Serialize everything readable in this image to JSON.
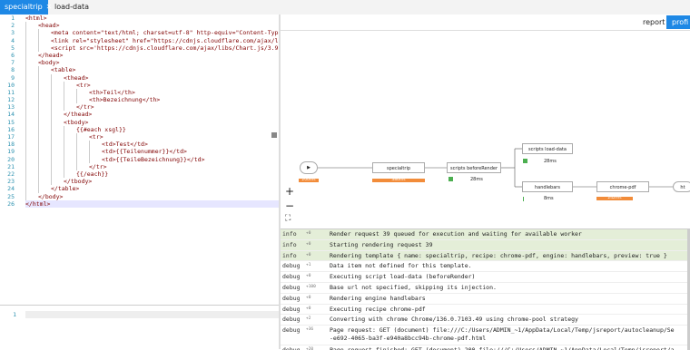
{
  "tabs": [
    {
      "label": "specialtrip",
      "close": "✕",
      "active": true
    },
    {
      "label": "load-data",
      "close": "✕",
      "active": false
    }
  ],
  "toolbar": {
    "report": "report",
    "profile": "profi"
  },
  "code": {
    "line_numbers": [
      "1",
      "2",
      "3",
      "4",
      "5",
      "6",
      "7",
      "8",
      "9",
      "10",
      "11",
      "12",
      "13",
      "14",
      "15",
      "16",
      "17",
      "18",
      "19",
      "20",
      "21",
      "22",
      "23",
      "24",
      "25",
      "26"
    ],
    "lines": [
      {
        "indent": 0,
        "text": "<html>"
      },
      {
        "indent": 1,
        "text": "<head>"
      },
      {
        "indent": 2,
        "text": "<meta content=\"text/html; charset=utf-8\" http-equiv=\"Content-Type\">"
      },
      {
        "indent": 2,
        "text": "<link rel=\"stylesheet\" href=\"https://cdnjs.cloudflare.com/ajax/libs/metr"
      },
      {
        "indent": 2,
        "text": "<script src='https://cdnjs.cloudflare.com/ajax/libs/Chart.js/3.9.1/chart"
      },
      {
        "indent": 1,
        "text": "</head>"
      },
      {
        "indent": 1,
        "text": "<body>"
      },
      {
        "indent": 2,
        "text": "<table>"
      },
      {
        "indent": 3,
        "text": "<thead>"
      },
      {
        "indent": 4,
        "text": "<tr>"
      },
      {
        "indent": 5,
        "text": "<th>Teil</th>"
      },
      {
        "indent": 5,
        "text": "<th>Bezeichnung</th>"
      },
      {
        "indent": 4,
        "text": "</tr>"
      },
      {
        "indent": 3,
        "text": "</thead>"
      },
      {
        "indent": 3,
        "text": "<tbody>"
      },
      {
        "indent": 4,
        "text": "{{#each xsgl}}"
      },
      {
        "indent": 5,
        "text": "<tr>"
      },
      {
        "indent": 6,
        "text": "<td>Test</td>"
      },
      {
        "indent": 6,
        "text": "<td>{{Teilenummer}}</td>"
      },
      {
        "indent": 6,
        "text": "<td>{{TeileBezeichnung}}</td>"
      },
      {
        "indent": 5,
        "text": "</tr>"
      },
      {
        "indent": 4,
        "text": "{{/each}}"
      },
      {
        "indent": 3,
        "text": "</tbody>"
      },
      {
        "indent": 2,
        "text": "</table>"
      },
      {
        "indent": 1,
        "text": "</body>"
      },
      {
        "indent": 0,
        "text": "</html>"
      }
    ]
  },
  "bottom_editor": {
    "line_number": "1"
  },
  "diagram": {
    "start_label": "▶",
    "nodes": {
      "specialtrip": "specialtrip",
      "before_render": "scripts beforeRender",
      "load_data": "scripts load-data",
      "handlebars": "handlebars",
      "chrome_pdf": "chrome-pdf",
      "more": "ht"
    },
    "times": {
      "start": "200ms",
      "specialtrip": "386ms",
      "before_render": "28ms",
      "load_data": "28ms",
      "handlebars": "8ms",
      "chrome_pdf": "242ms",
      "chrome_pdf_bar": "242ms"
    },
    "zoom": {
      "plus": "+",
      "minus": "−",
      "fit": "⛶"
    }
  },
  "logs": [
    {
      "level": "info",
      "delta": "+0",
      "message": "Render request 39 queued for execution and waiting for available worker"
    },
    {
      "level": "info",
      "delta": "+0",
      "message": "Starting rendering request 39"
    },
    {
      "level": "info",
      "delta": "+0",
      "message": "Rendering template { name: specialtrip, recipe: chrome-pdf, engine: handlebars, preview: true }"
    },
    {
      "level": "debug",
      "delta": "+1",
      "message": "Data item not defined for this template."
    },
    {
      "level": "debug",
      "delta": "+0",
      "message": "Executing script load-data (beforeRender)"
    },
    {
      "level": "debug",
      "delta": "+100",
      "message": "Base url not specified, skipping its injection."
    },
    {
      "level": "debug",
      "delta": "+0",
      "message": "Rendering engine handlebars"
    },
    {
      "level": "debug",
      "delta": "+0",
      "message": "Executing recipe chrome-pdf"
    },
    {
      "level": "debug",
      "delta": "+2",
      "message": "Converting with chrome Chrome/136.0.7103.49 using chrome-pool strategy"
    },
    {
      "level": "debug",
      "delta": "+36",
      "message": "Page request: GET (document) file:///C:/Users/ADMIN_~1/AppData/Local/Temp/jsreport/autocleanup/Se",
      "message2": "-e692-4065-ba3f-e940a8bcc94b-chrome-pdf.html"
    },
    {
      "level": "debug",
      "delta": "+20",
      "message": "Page request finished: GET (document) 200 file:///C:/Users/ADMIN_~1/AppData/Local/Temp/jsreport/a"
    }
  ],
  "colors": {
    "accent": "#1e88e5",
    "info_row": "#e4eed8",
    "bar": "#f28c3a",
    "green": "#4caf50",
    "tag": "#800000"
  }
}
